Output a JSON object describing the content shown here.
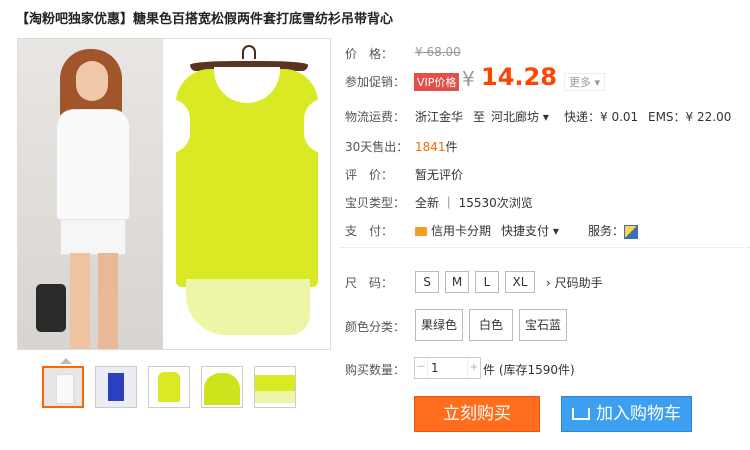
{
  "title": "【淘粉吧独家优惠】糖果色百搭宽松假两件套打底雪纺衫吊带背心",
  "price": {
    "label": "价　格：",
    "original": "¥ 68.00",
    "promo_label": "参加促销：",
    "vip_badge": "VIP价格",
    "currency": "¥",
    "value": "14.28",
    "more": "更多 ▾"
  },
  "shipping": {
    "label": "物流运费：",
    "from": "浙江金华",
    "sep": "至",
    "to": "河北廊坊 ▾",
    "express": "快递：¥ 0.01",
    "ems": "EMS：¥ 22.00"
  },
  "sales": {
    "label": "30天售出：",
    "count": "1841",
    "unit": "件"
  },
  "rating": {
    "label": "评　价：",
    "value": "暂无评价"
  },
  "baby_type": {
    "label": "宝贝类型：",
    "value": "全新 ｜ 15530次浏览"
  },
  "payment": {
    "label": "支　付：",
    "credit": "信用卡分期",
    "quick": "快捷支付 ▾",
    "service_label": "服务："
  },
  "size": {
    "label": "尺　码：",
    "options": [
      "S",
      "M",
      "L",
      "XL"
    ],
    "helper": "› 尺码助手"
  },
  "color": {
    "label": "颜色分类：",
    "options": [
      "果绿色",
      "白色",
      "宝石蓝"
    ]
  },
  "quantity": {
    "label": "购买数量：",
    "minus": "－",
    "value": "1",
    "plus": "+",
    "stock": "件 (库存1590件)"
  },
  "actions": {
    "buy": "立刻购买",
    "cart": "加入购物车"
  },
  "thumbnails": [
    {
      "name": "white-outfit",
      "colors": [
        "#e8e8e8",
        "#f8f8f8"
      ]
    },
    {
      "name": "blue-outfit",
      "colors": [
        "#ececf4",
        "#2c3fbf"
      ]
    },
    {
      "name": "green-top",
      "colors": [
        "#ffffff",
        "#d9ea24"
      ]
    },
    {
      "name": "green-detail",
      "colors": [
        "#f2f2f2",
        "#cde31c"
      ]
    },
    {
      "name": "green-hem",
      "colors": [
        "#ffffff",
        "#e8f29a"
      ]
    }
  ],
  "colors": {
    "accent": "#ff4400",
    "buy_button": "#ff6d1d",
    "cart_button": "#3d9ff0",
    "product": "#d9ea24"
  }
}
